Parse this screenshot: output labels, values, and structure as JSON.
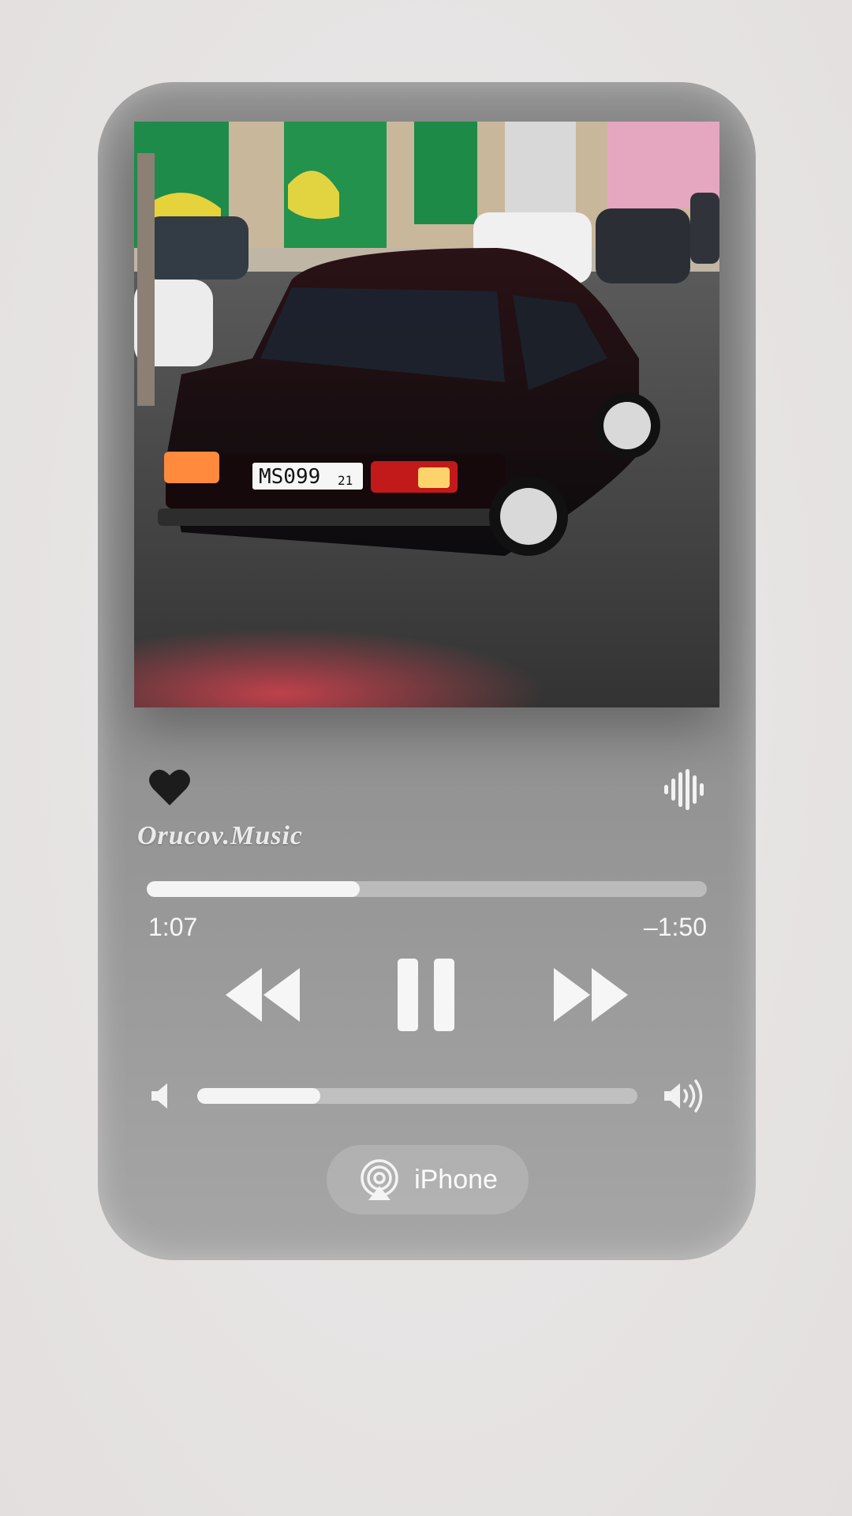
{
  "player": {
    "watermark": "Orucov.Music",
    "artwork_plate": "MS099",
    "artwork_plate_region": "21",
    "favorite_icon": "heart-icon",
    "audio_icon": "waveform-icon",
    "progress": {
      "elapsed": "1:07",
      "remaining": "–1:50",
      "fraction": 0.38
    },
    "controls": {
      "rewind_icon": "rewind-icon",
      "pause_icon": "pause-icon",
      "forward_icon": "fast-forward-icon"
    },
    "volume": {
      "low_icon": "speaker-low-icon",
      "high_icon": "speaker-high-icon",
      "fraction": 0.28
    },
    "output": {
      "icon": "airplay-icon",
      "label": "iPhone"
    }
  },
  "colors": {
    "panel": "#8f8f8f",
    "track": "#c4c4c4",
    "fill": "#f4f4f4",
    "heart": "#1c1c1c"
  }
}
